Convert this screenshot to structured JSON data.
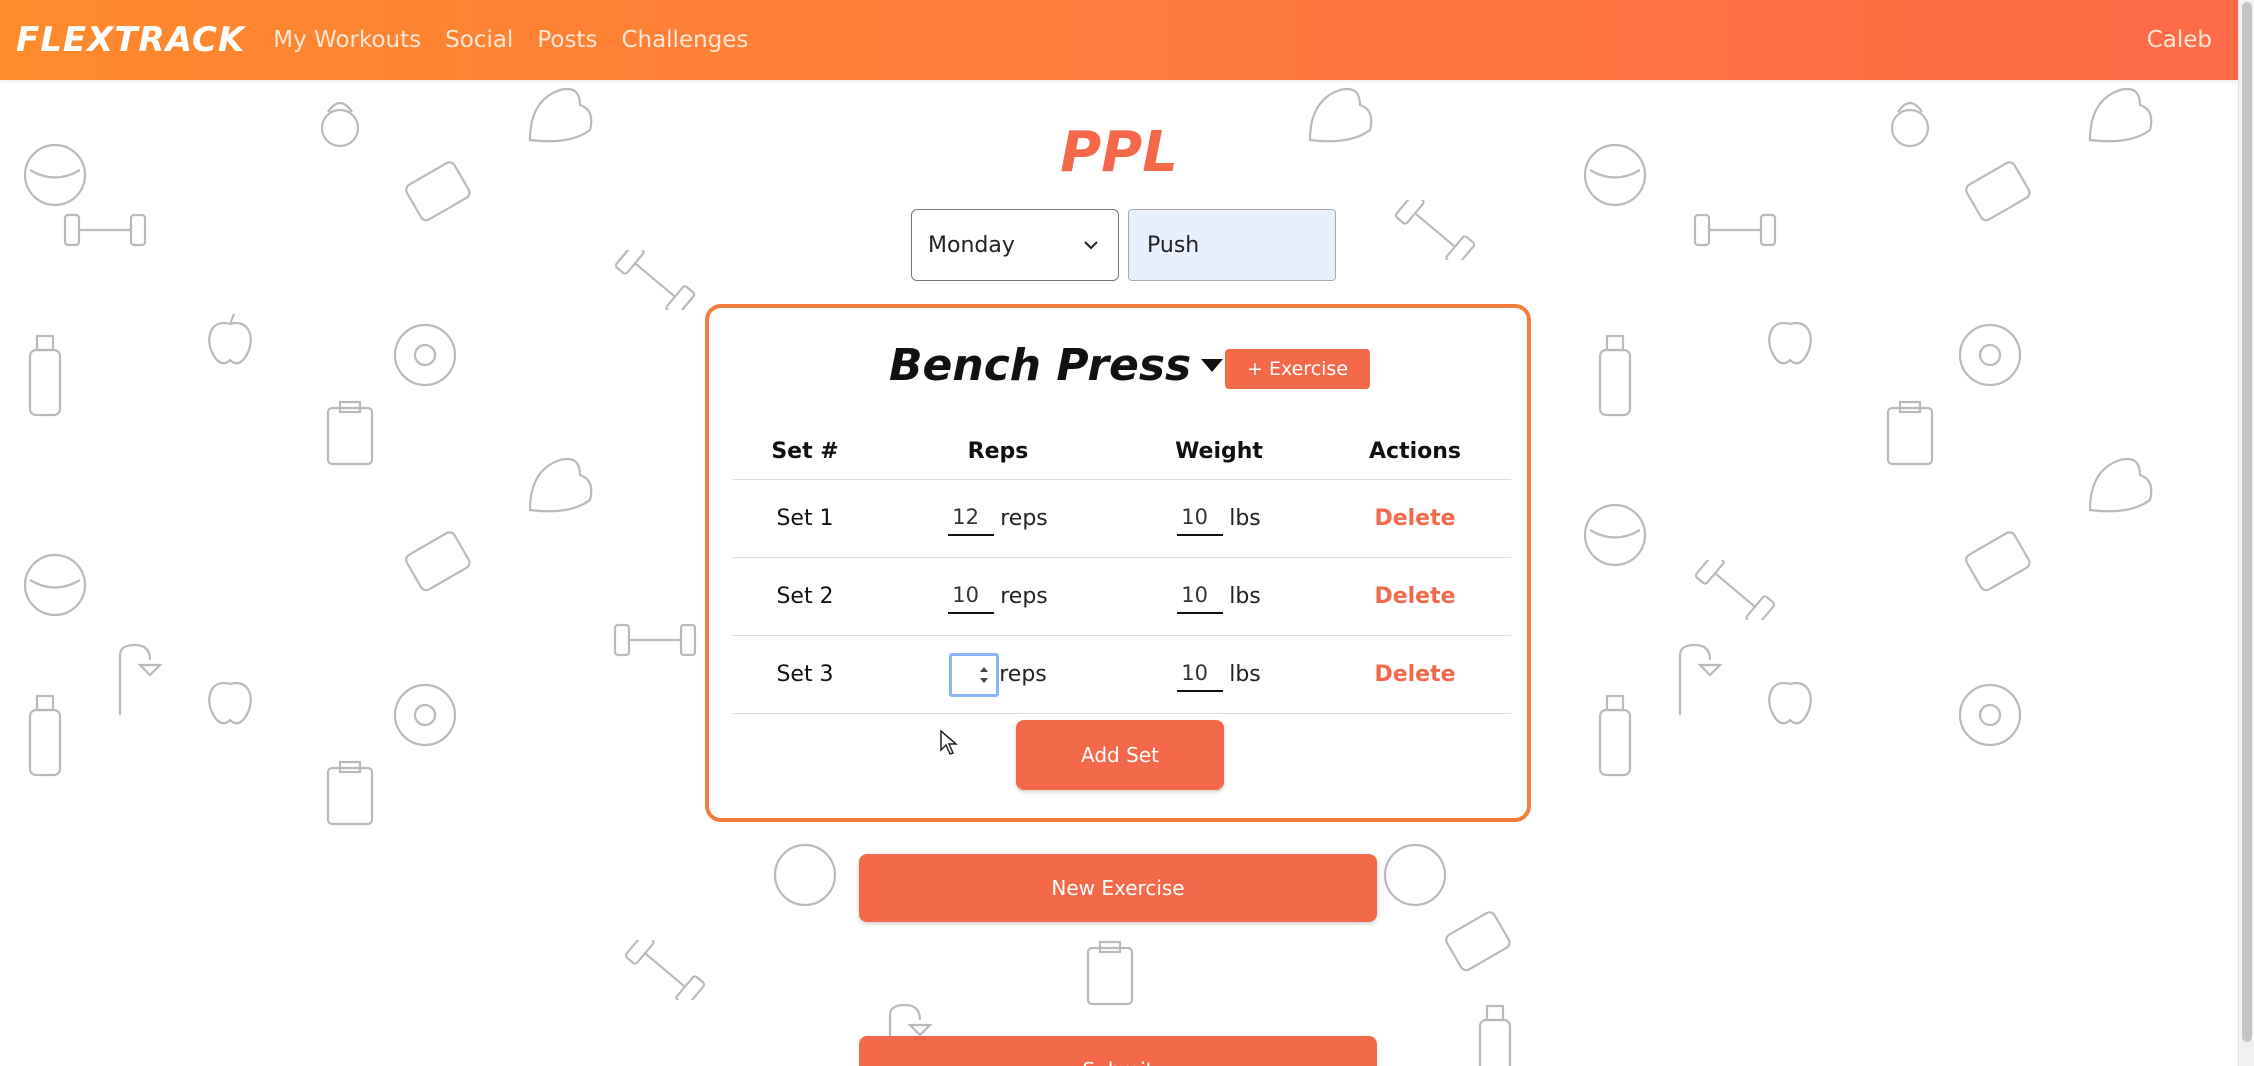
{
  "navbar": {
    "brand": "FLEXTRACK",
    "links": [
      "My Workouts",
      "Social",
      "Posts",
      "Challenges"
    ],
    "user": "Caleb"
  },
  "page": {
    "title": "PPL",
    "day_select": {
      "selected": "Monday"
    },
    "split_name": "Push"
  },
  "exercise_card": {
    "exercise_name": "Bench Press",
    "add_exercise_label": "+ Exercise",
    "table": {
      "headers": [
        "Set #",
        "Reps",
        "Weight",
        "Actions"
      ],
      "rows": [
        {
          "set": "Set 1",
          "reps": "12",
          "reps_unit": "reps",
          "weight": "10",
          "weight_unit": "lbs",
          "action": "Delete"
        },
        {
          "set": "Set 2",
          "reps": "10",
          "reps_unit": "reps",
          "weight": "10",
          "weight_unit": "lbs",
          "action": "Delete"
        },
        {
          "set": "Set 3",
          "reps": "",
          "reps_unit": "reps",
          "weight": "10",
          "weight_unit": "lbs",
          "action": "Delete"
        }
      ]
    },
    "add_set_label": "Add Set"
  },
  "new_exercise_label": "New Exercise",
  "submit_label": "Submit",
  "colors": {
    "accent": "#f4694a",
    "nav_gradient_start": "#ff8a2c",
    "nav_gradient_end": "#ff6a48",
    "card_border": "#f47c3c"
  }
}
